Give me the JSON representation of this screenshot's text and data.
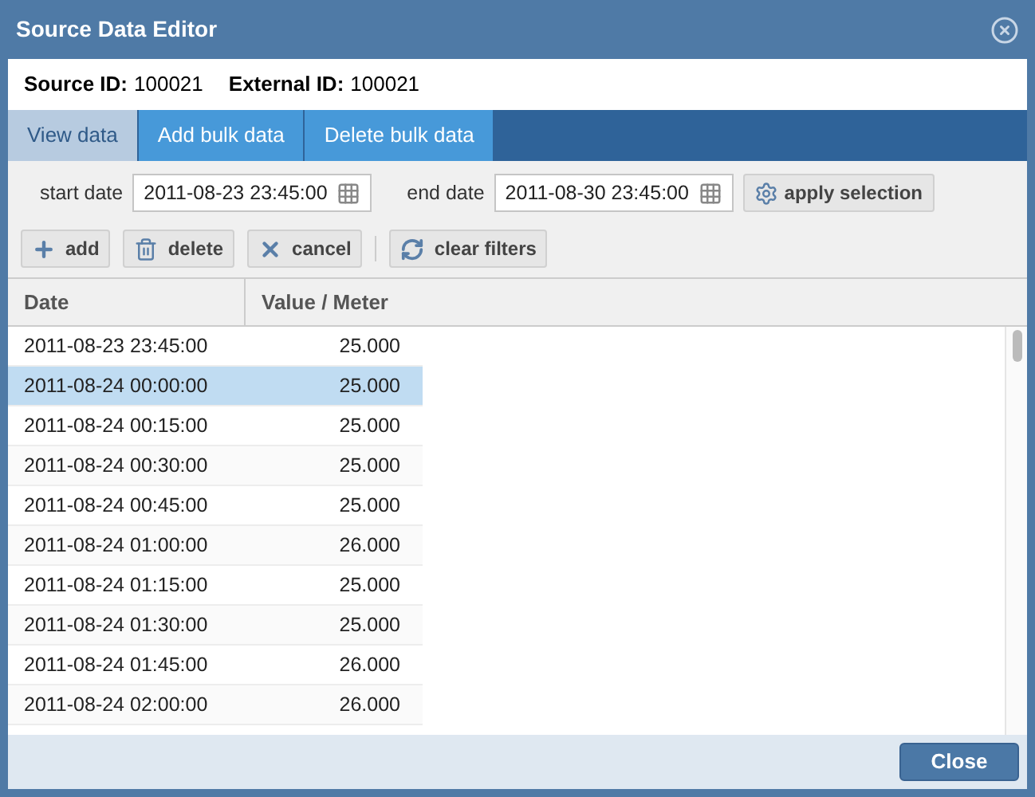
{
  "window": {
    "title": "Source Data Editor"
  },
  "info": [
    {
      "label": "Source ID:",
      "value": "100021"
    },
    {
      "label": "External ID:",
      "value": "100021"
    }
  ],
  "tabs": [
    {
      "label": "View data",
      "selected": true
    },
    {
      "label": "Add bulk data",
      "selected": false
    },
    {
      "label": "Delete bulk data",
      "selected": false
    }
  ],
  "filters": {
    "start_label": "start date",
    "start_value": "2011-08-23 23:45:00",
    "end_label": "end date",
    "end_value": "2011-08-30 23:45:00",
    "apply_button": "apply selection"
  },
  "toolbar": [
    {
      "kind": "add",
      "label": "add"
    },
    {
      "kind": "delete",
      "label": "delete"
    },
    {
      "kind": "cancel",
      "label": "cancel"
    },
    {
      "kind": "refresh",
      "label": "clear filters"
    }
  ],
  "table": {
    "columns": [
      "Date",
      "Value / Meter"
    ],
    "rows": [
      {
        "date": "2011-08-23 23:45:00",
        "value": "25.000",
        "selected": false
      },
      {
        "date": "2011-08-24 00:00:00",
        "value": "25.000",
        "selected": true
      },
      {
        "date": "2011-08-24 00:15:00",
        "value": "25.000",
        "selected": false
      },
      {
        "date": "2011-08-24 00:30:00",
        "value": "25.000",
        "selected": false
      },
      {
        "date": "2011-08-24 00:45:00",
        "value": "25.000",
        "selected": false
      },
      {
        "date": "2011-08-24 01:00:00",
        "value": "26.000",
        "selected": false
      },
      {
        "date": "2011-08-24 01:15:00",
        "value": "25.000",
        "selected": false
      },
      {
        "date": "2011-08-24 01:30:00",
        "value": "25.000",
        "selected": false
      },
      {
        "date": "2011-08-24 01:45:00",
        "value": "26.000",
        "selected": false
      },
      {
        "date": "2011-08-24 02:00:00",
        "value": "26.000",
        "selected": false
      }
    ]
  },
  "footer": {
    "close_button": "Close"
  }
}
